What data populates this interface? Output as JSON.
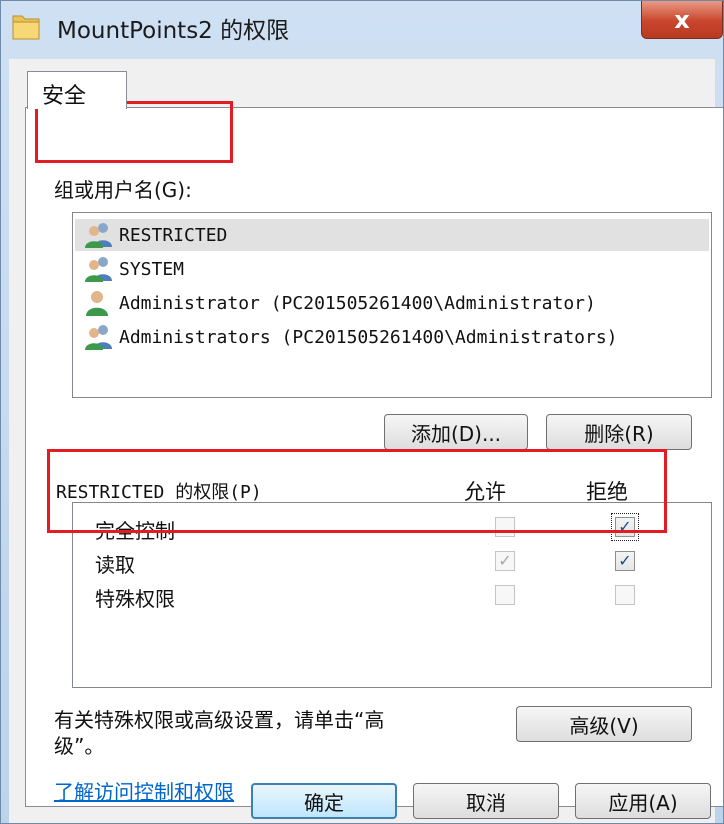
{
  "window": {
    "title": "MountPoints2 的权限"
  },
  "tab": {
    "label": "安全"
  },
  "groups": {
    "label": "组或用户名(G):",
    "items": [
      {
        "name": "RESTRICTED",
        "selected": true
      },
      {
        "name": "SYSTEM",
        "selected": false
      },
      {
        "name": "Administrator (PC201505261400\\Administrator)",
        "selected": false
      },
      {
        "name": "Administrators (PC201505261400\\Administrators)",
        "selected": false
      }
    ]
  },
  "buttons": {
    "add": "添加(D)...",
    "remove": "删除(R)",
    "advanced": "高级(V)",
    "ok": "确定",
    "cancel": "取消",
    "apply": "应用(A)"
  },
  "permissions": {
    "label": "RESTRICTED 的权限(P)",
    "allow_header": "允许",
    "deny_header": "拒绝",
    "rows": [
      {
        "name": "完全控制",
        "allow": false,
        "allow_disabled": true,
        "deny": true
      },
      {
        "name": "读取",
        "allow": true,
        "allow_disabled": true,
        "deny": true
      },
      {
        "name": "特殊权限",
        "allow": false,
        "allow_disabled": true,
        "deny": false
      }
    ]
  },
  "advanced_hint": {
    "line1": "有关特殊权限或高级设置，请单击“高",
    "line2": "级”。"
  },
  "help_link": "了解访问控制和权限",
  "close_glyph": "x",
  "check_glyph": "✓",
  "colors": {
    "highlight_box": "#e31b23",
    "link": "#0066cc",
    "selection": "#e1e1e1"
  }
}
